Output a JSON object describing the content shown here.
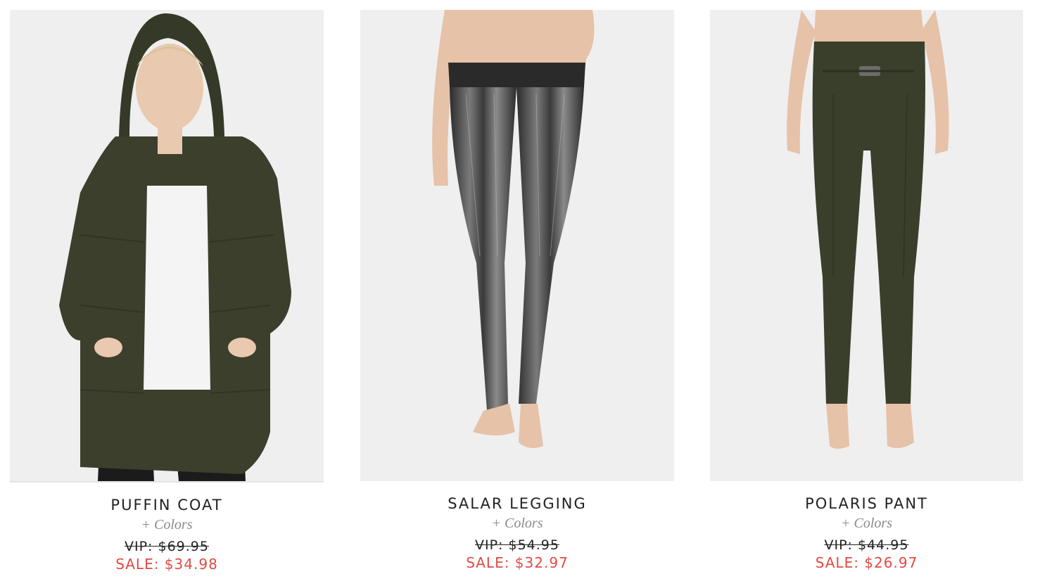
{
  "products": [
    {
      "name": "PUFFIN COAT",
      "colors_link": "+ Colors",
      "vip_price": "VIP: $69.95",
      "sale_price": "SALE: $34.98",
      "image": "puffin-coat-photo"
    },
    {
      "name": "SALAR LEGGING",
      "colors_link": "+ Colors",
      "vip_price": "VIP: $54.95",
      "sale_price": "SALE: $32.97",
      "image": "salar-legging-photo"
    },
    {
      "name": "POLARIS PANT",
      "colors_link": "+ Colors",
      "vip_price": "VIP: $44.95",
      "sale_price": "SALE: $26.97",
      "image": "polaris-pant-photo"
    }
  ],
  "colors": {
    "sale_red": "#e24b42",
    "olive": "#3b3f2c",
    "metallic": "#4a4a4a"
  }
}
